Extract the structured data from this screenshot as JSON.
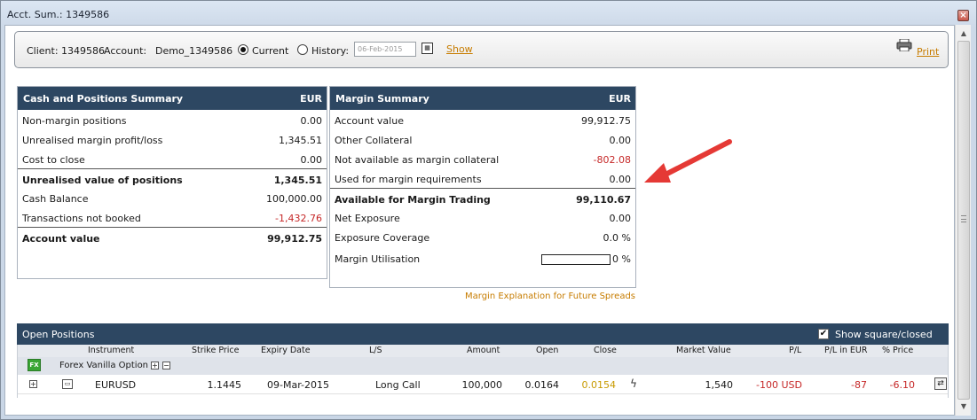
{
  "window": {
    "title": "Acct. Sum.: 1349586"
  },
  "filter": {
    "client_label": "Client: 1349586",
    "account_label": "Account:",
    "account_value": "Demo_1349586",
    "current_label": "Current",
    "history_label": "History:",
    "date_placeholder": "06-Feb-2015",
    "show_label": "Show",
    "print_label": "Print"
  },
  "cash_summary": {
    "title": "Cash and Positions Summary",
    "currency": "EUR",
    "rows": [
      {
        "label": "Non-margin positions",
        "value": "0.00"
      },
      {
        "label": "Unrealised margin profit/loss",
        "value": "1,345.51"
      },
      {
        "label": "Cost to close",
        "value": "0.00"
      },
      {
        "label": "Unrealised value of positions",
        "value": "1,345.51"
      },
      {
        "label": "Cash Balance",
        "value": "100,000.00"
      },
      {
        "label": "Transactions not booked",
        "value": "-1,432.76"
      },
      {
        "label": "Account value",
        "value": "99,912.75"
      }
    ]
  },
  "margin_summary": {
    "title": "Margin Summary",
    "currency": "EUR",
    "rows": [
      {
        "label": "Account value",
        "value": "99,912.75"
      },
      {
        "label": "Other Collateral",
        "value": "0.00"
      },
      {
        "label": "Not available as margin collateral",
        "value": "-802.08"
      },
      {
        "label": "Used for margin requirements",
        "value": "0.00"
      },
      {
        "label": "Available for Margin Trading",
        "value": "99,110.67"
      },
      {
        "label": "Net Exposure",
        "value": "0.00"
      },
      {
        "label": "Exposure Coverage",
        "value": "0.0 %"
      },
      {
        "label": "Margin Utilisation",
        "value": "0 %"
      }
    ],
    "utilisation_fraction": 0,
    "future_spreads_link": "Margin Explanation for Future Spreads"
  },
  "open_positions": {
    "title": "Open Positions",
    "show_closed_label": "Show square/closed",
    "show_closed_checked": true,
    "columns": [
      "Instrument",
      "Strike Price",
      "Expiry Date",
      "L/S",
      "Amount",
      "Open",
      "Close",
      "Market Value",
      "P/L",
      "P/L in EUR",
      "% Price"
    ],
    "group": {
      "name": "Forex Vanilla Option",
      "icon": "fx-option-icon"
    },
    "rows": [
      {
        "instrument": "EURUSD",
        "strike_price": "1.1445",
        "expiry_date": "09-Mar-2015",
        "ls": "Long Call",
        "amount": "100,000",
        "open": "0.0164",
        "close": "0.0154",
        "market_value": "1,540",
        "pl": "-100 USD",
        "pl_eur": "-87",
        "pct_price": "-6.10"
      }
    ]
  },
  "colors": {
    "panel_header": "#2d4762",
    "link": "#c77c00",
    "negative": "#c62828",
    "arrow": "#e53935"
  }
}
